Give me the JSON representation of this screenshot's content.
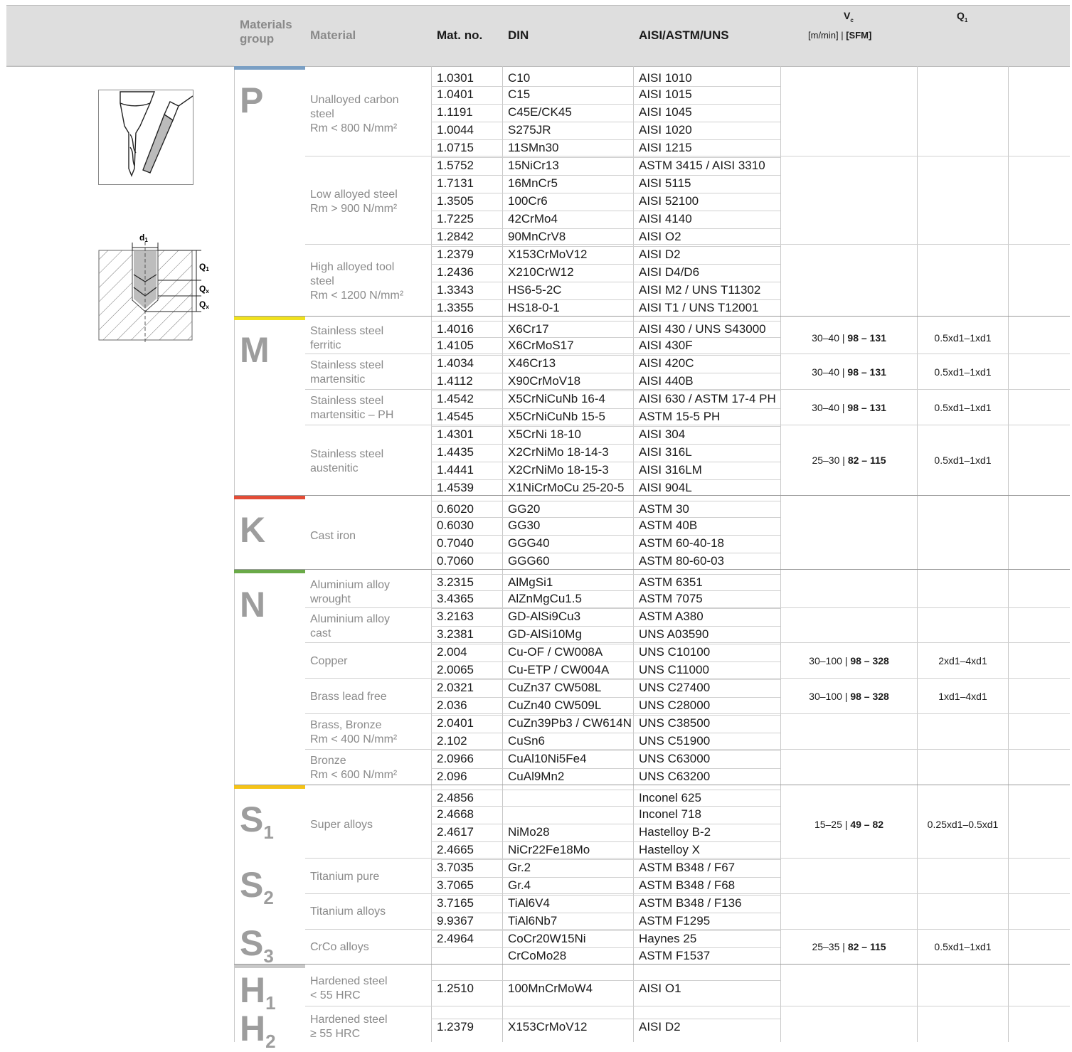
{
  "header": {
    "materials_group": "Materials group",
    "material": "Material",
    "mat_no": "Mat. no.",
    "din": "DIN",
    "aisi": "AISI/ASTM/UNS",
    "vc": "V",
    "vc_sub": "c",
    "vc_unit": "[m/min] | ",
    "vc_unit_bold": "[SFM]",
    "q1": "Q",
    "q1_sub": "1"
  },
  "diagram": {
    "d1": "d",
    "d1_sub": "1",
    "q1": "Q",
    "q1_sub": "1",
    "qx1": "Q",
    "qx1_sub": "x",
    "qx2": "Q",
    "qx2_sub": "x"
  },
  "colors": {
    "P": "#7a9fc4",
    "M": "#f0e11e",
    "K": "#e34c36",
    "N": "#6aaa48",
    "S": "#f5c317",
    "H": "#c8c8c8"
  },
  "groups": [
    {
      "letter": "P",
      "sub": ""
    },
    {
      "letter": "M",
      "sub": ""
    },
    {
      "letter": "K",
      "sub": ""
    },
    {
      "letter": "N",
      "sub": ""
    },
    {
      "letter": "S",
      "sub": "1"
    },
    {
      "letter": "S",
      "sub": "2"
    },
    {
      "letter": "S",
      "sub": "3"
    },
    {
      "letter": "H",
      "sub": "1"
    },
    {
      "letter": "H",
      "sub": "2"
    }
  ],
  "materials": [
    {
      "lines": [
        "Unalloyed carbon",
        "steel",
        "Rm < 800 N/mm²"
      ]
    },
    {
      "lines": [
        "Low alloyed steel",
        "Rm > 900 N/mm²"
      ]
    },
    {
      "lines": [
        "High alloyed tool",
        "steel",
        "Rm < 1200 N/mm²"
      ]
    },
    {
      "lines": [
        "Stainless steel",
        "ferritic"
      ]
    },
    {
      "lines": [
        "Stainless steel",
        "martensitic"
      ]
    },
    {
      "lines": [
        "Stainless steel",
        "martensitic – PH"
      ]
    },
    {
      "lines": [
        "Stainless steel",
        "austenitic"
      ]
    },
    {
      "lines": [
        "Cast iron"
      ]
    },
    {
      "lines": [
        "Aluminium alloy",
        "wrought"
      ]
    },
    {
      "lines": [
        "Aluminium alloy",
        "cast"
      ]
    },
    {
      "lines": [
        "Copper"
      ]
    },
    {
      "lines": [
        "Brass lead free"
      ]
    },
    {
      "lines": [
        "Brass, Bronze",
        "Rm < 400 N/mm²"
      ]
    },
    {
      "lines": [
        "Bronze",
        "Rm < 600 N/mm²"
      ]
    },
    {
      "lines": [
        "Super alloys"
      ]
    },
    {
      "lines": [
        "Titanium pure"
      ]
    },
    {
      "lines": [
        "Titanium alloys"
      ]
    },
    {
      "lines": [
        "CrCo alloys"
      ]
    },
    {
      "lines": [
        "Hardened steel",
        "< 55 HRC"
      ]
    },
    {
      "lines": [
        "Hardened steel",
        "≥ 55 HRC"
      ]
    }
  ],
  "rows": [
    [
      "1.0301",
      "C10",
      "AISI 1010"
    ],
    [
      "1.0401",
      "C15",
      "AISI 1015"
    ],
    [
      "1.1191",
      "C45E/CK45",
      "AISI 1045"
    ],
    [
      "1.0044",
      "S275JR",
      "AISI 1020"
    ],
    [
      "1.0715",
      "11SMn30",
      "AISI 1215"
    ],
    [
      "1.5752",
      "15NiCr13",
      "ASTM 3415 / AISI 3310"
    ],
    [
      "1.7131",
      "16MnCr5",
      "AISI 5115"
    ],
    [
      "1.3505",
      "100Cr6",
      "AISI 52100"
    ],
    [
      "1.7225",
      "42CrMo4",
      "AISI 4140"
    ],
    [
      "1.2842",
      "90MnCrV8",
      "AISI O2"
    ],
    [
      "1.2379",
      "X153CrMoV12",
      "AISI D2"
    ],
    [
      "1.2436",
      "X210CrW12",
      "AISI D4/D6"
    ],
    [
      "1.3343",
      "HS6-5-2C",
      "AISI M2 / UNS T11302"
    ],
    [
      "1.3355",
      "HS18-0-1",
      "AISI T1 / UNS T12001"
    ],
    [
      "1.4016",
      "X6Cr17",
      "AISI 430 / UNS S43000"
    ],
    [
      "1.4105",
      "X6CrMoS17",
      "AISI 430F"
    ],
    [
      "1.4034",
      "X46Cr13",
      "AISI 420C"
    ],
    [
      "1.4112",
      "X90CrMoV18",
      "AISI 440B"
    ],
    [
      "1.4542",
      "X5CrNiCuNb 16-4",
      "AISI 630 / ASTM 17-4 PH"
    ],
    [
      "1.4545",
      "X5CrNiCuNb 15-5",
      "ASTM 15-5 PH"
    ],
    [
      "1.4301",
      "X5CrNi 18-10",
      "AISI 304"
    ],
    [
      "1.4435",
      "X2CrNiMo 18-14-3",
      "AISI 316L"
    ],
    [
      "1.4441",
      "X2CrNiMo 18-15-3",
      "AISI 316LM"
    ],
    [
      "1.4539",
      "X1NiCrMoCu 25-20-5",
      "AISI 904L"
    ],
    [
      "0.6020",
      "GG20",
      "ASTM 30"
    ],
    [
      "0.6030",
      "GG30",
      "ASTM 40B"
    ],
    [
      "0.7040",
      "GGG40",
      "ASTM 60-40-18"
    ],
    [
      "0.7060",
      "GGG60",
      "ASTM 80-60-03"
    ],
    [
      "3.2315",
      "AlMgSi1",
      "ASTM 6351"
    ],
    [
      "3.4365",
      "AlZnMgCu1.5",
      "ASTM 7075"
    ],
    [
      "3.2163",
      "GD-AlSi9Cu3",
      "ASTM A380"
    ],
    [
      "3.2381",
      "GD-AlSi10Mg",
      "UNS A03590"
    ],
    [
      "2.004",
      "Cu-OF / CW008A",
      "UNS C10100"
    ],
    [
      "2.0065",
      "Cu-ETP / CW004A",
      "UNS C11000"
    ],
    [
      "2.0321",
      "CuZn37 CW508L",
      "UNS C27400"
    ],
    [
      "2.036",
      "CuZn40 CW509L",
      "UNS C28000"
    ],
    [
      "2.0401",
      "CuZn39Pb3 / CW614N",
      "UNS C38500"
    ],
    [
      "2.102",
      "CuSn6",
      "UNS C51900"
    ],
    [
      "2.0966",
      "CuAl10Ni5Fe4",
      "UNS C63000"
    ],
    [
      "2.096",
      "CuAl9Mn2",
      "UNS C63200"
    ],
    [
      "2.4856",
      "",
      "Inconel 625"
    ],
    [
      "2.4668",
      "",
      "Inconel 718"
    ],
    [
      "2.4617",
      "NiMo28",
      "Hastelloy B-2"
    ],
    [
      "2.4665",
      "NiCr22Fe18Mo",
      "Hastelloy X"
    ],
    [
      "3.7035",
      "Gr.2",
      "ASTM B348 / F67"
    ],
    [
      "3.7065",
      "Gr.4",
      "ASTM B348 / F68"
    ],
    [
      "3.7165",
      "TiAl6V4",
      "ASTM B348 / F136"
    ],
    [
      "9.9367",
      "TiAl6Nb7",
      "ASTM F1295"
    ],
    [
      "2.4964",
      "CoCr20W15Ni",
      "Haynes 25"
    ],
    [
      "",
      "CrCoMo28",
      "ASTM F1537"
    ],
    [
      "1.2510",
      "100MnCrMoW4",
      "AISI O1"
    ],
    [
      "1.2379",
      "X153CrMoV12",
      "AISI D2"
    ]
  ],
  "cutting": [
    {
      "vc": "30–40 | ",
      "sfm": "98 – 131",
      "q1": "0.5xd1–1xd1"
    },
    {
      "vc": "30–40 | ",
      "sfm": "98 – 131",
      "q1": "0.5xd1–1xd1"
    },
    {
      "vc": "30–40 | ",
      "sfm": "98 – 131",
      "q1": "0.5xd1–1xd1"
    },
    {
      "vc": "25–30 | ",
      "sfm": "82 – 115",
      "q1": "0.5xd1–1xd1"
    },
    {
      "vc": "30–100 | ",
      "sfm": "98 – 328",
      "q1": "2xd1–4xd1"
    },
    {
      "vc": "30–100 | ",
      "sfm": "98 – 328",
      "q1": "1xd1–4xd1"
    },
    {
      "vc": "15–25 | ",
      "sfm": "49 – 82",
      "q1": "0.25xd1–0.5xd1"
    },
    {
      "vc": "25–35 | ",
      "sfm": "82 – 115",
      "q1": "0.5xd1–1xd1"
    }
  ]
}
